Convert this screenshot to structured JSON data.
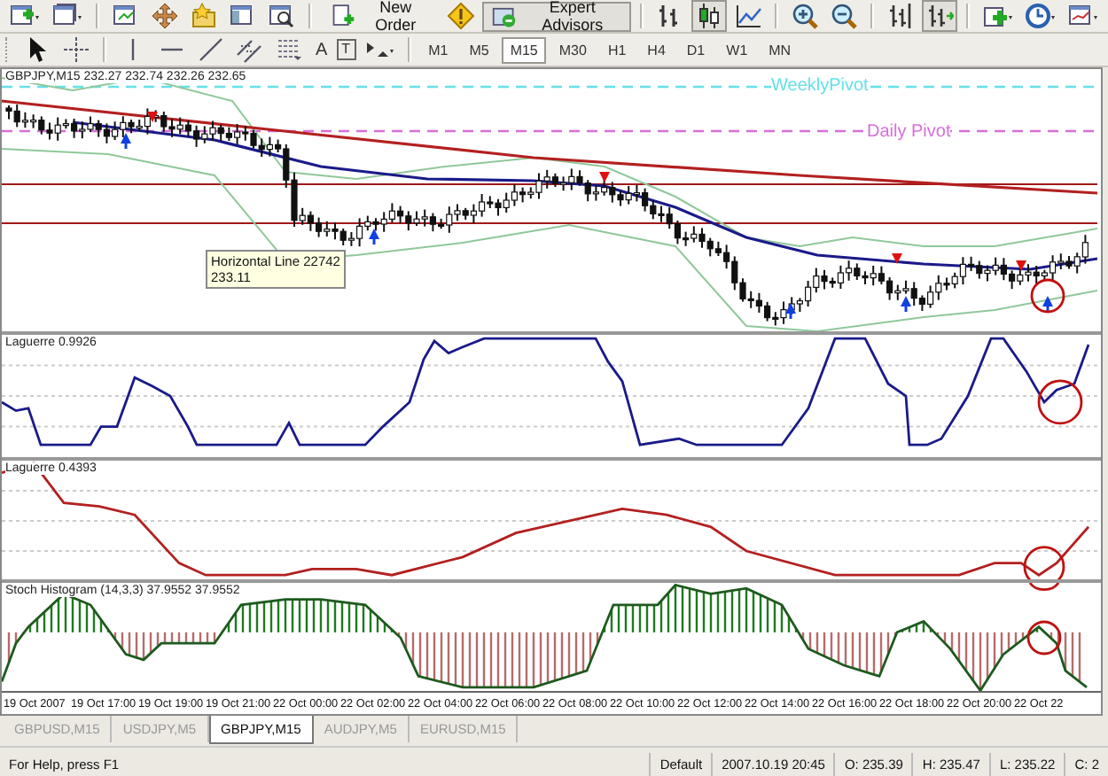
{
  "toolbar": [
    {
      "kind": "new-chart",
      "pressed": false
    },
    {
      "kind": "profiles",
      "pressed": false
    },
    {
      "kind": "market-watch",
      "pressed": false
    },
    {
      "kind": "move",
      "pressed": false
    },
    {
      "kind": "favorites",
      "pressed": false
    },
    {
      "kind": "navigator",
      "pressed": false
    },
    {
      "kind": "data-window",
      "pressed": false
    },
    {
      "kind": "order",
      "label": "New Order",
      "pressed": false
    },
    {
      "kind": "alert",
      "pressed": false
    },
    {
      "kind": "expert",
      "label": "Expert Advisors",
      "pressed": true
    },
    {
      "kind": "bar-chart",
      "pressed": false
    },
    {
      "kind": "candle-chart",
      "pressed": true
    },
    {
      "kind": "line-chart",
      "pressed": false
    },
    {
      "kind": "zoom-in",
      "pressed": false
    },
    {
      "kind": "zoom-out",
      "pressed": false
    },
    {
      "kind": "chart-shift",
      "pressed": false
    },
    {
      "kind": "auto-scroll",
      "pressed": true
    },
    {
      "kind": "indicators",
      "pressed": false
    },
    {
      "kind": "periods",
      "pressed": false
    },
    {
      "kind": "templates",
      "pressed": false
    }
  ],
  "drawing_tools": [
    {
      "kind": "cursor"
    },
    {
      "kind": "crosshair"
    },
    {
      "kind": "vertical-line"
    },
    {
      "kind": "horizontal-line"
    },
    {
      "kind": "trendline"
    },
    {
      "kind": "channel"
    },
    {
      "kind": "fibonacci"
    },
    {
      "kind": "text",
      "glyph": "A"
    },
    {
      "kind": "label",
      "glyph": "T"
    },
    {
      "kind": "arrows"
    }
  ],
  "timeframes": [
    {
      "label": "M1",
      "selected": false
    },
    {
      "label": "M5",
      "selected": false
    },
    {
      "label": "M15",
      "selected": true
    },
    {
      "label": "M30",
      "selected": false
    },
    {
      "label": "H1",
      "selected": false
    },
    {
      "label": "H4",
      "selected": false
    },
    {
      "label": "D1",
      "selected": false
    },
    {
      "label": "W1",
      "selected": false
    },
    {
      "label": "MN",
      "selected": false
    }
  ],
  "chart": {
    "title": "GBPJPY,M15  232.27 232.74 232.26 232.65",
    "pivots": [
      {
        "label": "WeeklyPivot",
        "color": "#66e0e8"
      },
      {
        "label": "Daily Pivot",
        "color": "#d86ed8"
      }
    ],
    "tooltip": [
      "Horizontal Line 22742",
      "233.11"
    ],
    "indicators": [
      {
        "kind": "laguerre-blue",
        "title": "Laguerre 0.9926"
      },
      {
        "kind": "laguerre-red",
        "title": "Laguerre 0.4393"
      },
      {
        "kind": "histogram",
        "title": "Stoch Histogram (14,3,3) 37.9552 37.9552"
      }
    ],
    "time_axis": [
      "19 Oct 2007",
      "19 Oct 17:00",
      "19 Oct 19:00",
      "19 Oct 21:00",
      "22 Oct 00:00",
      "22 Oct 02:00",
      "22 Oct 04:00",
      "22 Oct 06:00",
      "22 Oct 08:00",
      "22 Oct 10:00",
      "22 Oct 12:00",
      "22 Oct 14:00",
      "22 Oct 16:00",
      "22 Oct 18:00",
      "22 Oct 20:00",
      "22 Oct 22"
    ]
  },
  "chart_tabs": [
    {
      "label": "GBPUSD,M15",
      "selected": false
    },
    {
      "label": "USDJPY,M5",
      "selected": false
    },
    {
      "label": "GBPJPY,M15",
      "selected": true
    },
    {
      "label": "AUDJPY,M5",
      "selected": false
    },
    {
      "label": "EURUSD,M15",
      "selected": false
    }
  ],
  "status_bar": [
    "For Help, press F1",
    "Default",
    "2007.10.19 20:45",
    "O: 235.39",
    "H: 235.47",
    "L: 235.22",
    "C: 2"
  ]
}
